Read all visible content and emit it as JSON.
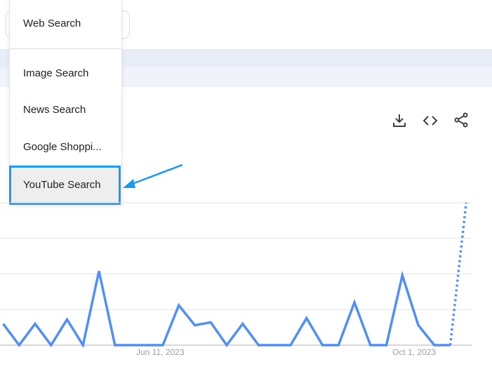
{
  "menu": {
    "items": [
      {
        "label": "Web Search"
      },
      {
        "label": "Image Search"
      },
      {
        "label": "News Search"
      },
      {
        "label": "Google Shoppi..."
      },
      {
        "label": "YouTube Search",
        "highlighted": true
      }
    ]
  },
  "toolbar": {
    "icons": [
      "download-icon",
      "embed-code-icon",
      "share-icon"
    ]
  },
  "colors": {
    "highlight_border": "#1a9bf0",
    "annotation_arrow": "#1a9bf0",
    "line": "#4f8ff7"
  },
  "chart_data": {
    "type": "line",
    "x_tick_labels": [
      "Jun 11, 2023",
      "Oct 1, 2023"
    ],
    "ylim": [
      0,
      100
    ],
    "grid": true,
    "x": [
      "2023-04-02",
      "2023-04-09",
      "2023-04-16",
      "2023-04-23",
      "2023-04-30",
      "2023-05-07",
      "2023-05-14",
      "2023-05-21",
      "2023-05-28",
      "2023-06-04",
      "2023-06-11",
      "2023-06-18",
      "2023-06-25",
      "2023-07-02",
      "2023-07-09",
      "2023-07-16",
      "2023-07-23",
      "2023-07-30",
      "2023-08-06",
      "2023-08-13",
      "2023-08-20",
      "2023-08-27",
      "2023-09-03",
      "2023-09-10",
      "2023-09-17",
      "2023-09-24",
      "2023-10-01",
      "2023-10-08",
      "2023-10-15",
      "2023-10-22"
    ],
    "values": [
      15,
      0,
      15,
      0,
      18,
      0,
      52,
      0,
      0,
      0,
      0,
      28,
      14,
      16,
      0,
      15,
      0,
      0,
      0,
      19,
      0,
      0,
      30,
      0,
      0,
      49,
      14,
      0,
      0,
      100
    ],
    "partial_last_point": true
  }
}
